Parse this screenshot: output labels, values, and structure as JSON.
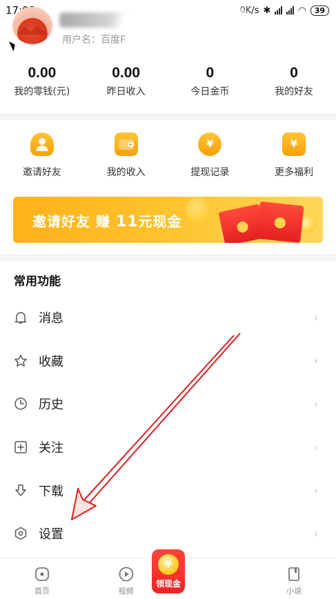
{
  "status_bar": {
    "time": "17:08",
    "network_speed": "0K/s",
    "battery": "39"
  },
  "profile": {
    "username_label": "用户名：百度F"
  },
  "stats": [
    {
      "value": "0.00",
      "label": "我的零钱(元)"
    },
    {
      "value": "0.00",
      "label": "昨日收入"
    },
    {
      "value": "0",
      "label": "今日金币"
    },
    {
      "value": "0",
      "label": "我的好友"
    }
  ],
  "actions": [
    {
      "label": "邀请好友",
      "icon": "person-icon"
    },
    {
      "label": "我的收入",
      "icon": "wallet-icon"
    },
    {
      "label": "提现记录",
      "icon": "coin-icon"
    },
    {
      "label": "更多福利",
      "icon": "gift-icon"
    }
  ],
  "banner": {
    "text_prefix": "邀请好友 赚 ",
    "amount": "11",
    "text_suffix": "元现金"
  },
  "section": {
    "title": "常用功能"
  },
  "menu": [
    {
      "label": "消息",
      "icon": "bell-icon"
    },
    {
      "label": "收藏",
      "icon": "star-icon"
    },
    {
      "label": "历史",
      "icon": "clock-icon"
    },
    {
      "label": "关注",
      "icon": "plus-square-icon"
    },
    {
      "label": "下载",
      "icon": "download-icon"
    },
    {
      "label": "设置",
      "icon": "settings-icon"
    }
  ],
  "menu_arrow": "›",
  "bottom_nav": {
    "home": "首页",
    "video": "视频",
    "cash": "领现金",
    "novel": "小说"
  },
  "colors": {
    "accent": "#f7a008",
    "banner": "#ffc531",
    "nav_cash": "#f12424",
    "annotation_arrow": "#d81e1e"
  }
}
